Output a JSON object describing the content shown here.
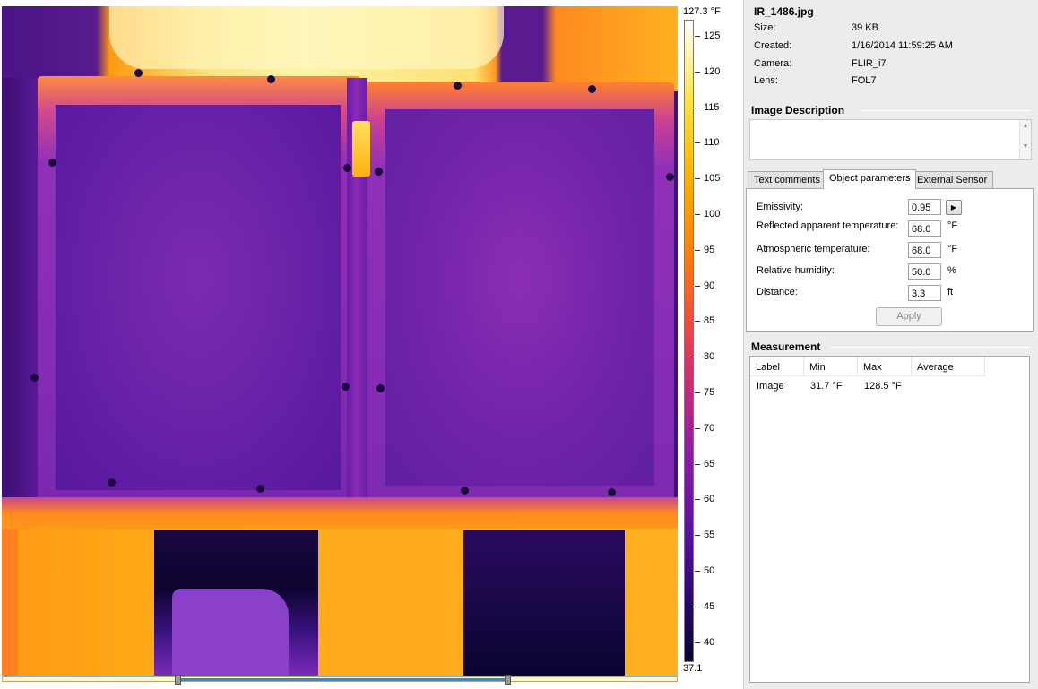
{
  "scale": {
    "max_label": "127.3 °F",
    "min_label": "37.1",
    "ticks": [
      "125",
      "120",
      "115",
      "110",
      "105",
      "100",
      "95",
      "90",
      "85",
      "80",
      "75",
      "70",
      "65",
      "60",
      "55",
      "50",
      "45",
      "40"
    ]
  },
  "slider": {
    "range_start": 0.26,
    "range_end": 0.75
  },
  "file": {
    "name": "IR_1486.jpg",
    "info": [
      {
        "key": "Size:",
        "value": "39 KB"
      },
      {
        "key": "Created:",
        "value": "1/16/2014 11:59:25 AM"
      },
      {
        "key": "Camera:",
        "value": "FLIR_i7"
      },
      {
        "key": "Lens:",
        "value": "FOL7"
      }
    ]
  },
  "description": {
    "title": "Image Description",
    "text": ""
  },
  "tabs": [
    {
      "label": "Text comments",
      "active": false
    },
    {
      "label": "Object parameters",
      "active": true
    },
    {
      "label": "External Sensor",
      "active": false
    }
  ],
  "params": {
    "emissivity": {
      "label": "Emissivity:",
      "value": "0.95"
    },
    "reflected": {
      "label": "Reflected apparent temperature:",
      "value": "68.0",
      "unit": "°F"
    },
    "atmospheric": {
      "label": "Atmospheric temperature:",
      "value": "68.0",
      "unit": "°F"
    },
    "humidity": {
      "label": "Relative humidity:",
      "value": "50.0",
      "unit": "%"
    },
    "distance": {
      "label": "Distance:",
      "value": "3.3",
      "unit": "ft"
    },
    "apply_label": "Apply"
  },
  "measurement": {
    "title": "Measurement",
    "columns": [
      "Label",
      "Min",
      "Max",
      "Average"
    ],
    "rows": [
      {
        "label": "Image",
        "min": "31.7 °F",
        "max": "128.5 °F",
        "average": ""
      }
    ]
  },
  "colors": {
    "hot": "#ffb000",
    "warm": "#ff7a10",
    "cool": "#6a1ab0",
    "cold": "#0a0430",
    "slider_range": "#2f8be0"
  }
}
